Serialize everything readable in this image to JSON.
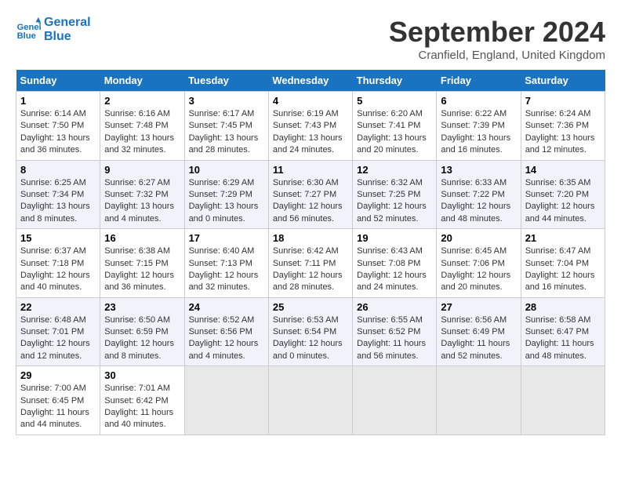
{
  "header": {
    "logo_line1": "General",
    "logo_line2": "Blue",
    "month": "September 2024",
    "location": "Cranfield, England, United Kingdom"
  },
  "weekdays": [
    "Sunday",
    "Monday",
    "Tuesday",
    "Wednesday",
    "Thursday",
    "Friday",
    "Saturday"
  ],
  "weeks": [
    [
      {
        "day": "1",
        "sunrise": "6:14 AM",
        "sunset": "7:50 PM",
        "daylight": "13 hours and 36 minutes."
      },
      {
        "day": "2",
        "sunrise": "6:16 AM",
        "sunset": "7:48 PM",
        "daylight": "13 hours and 32 minutes."
      },
      {
        "day": "3",
        "sunrise": "6:17 AM",
        "sunset": "7:45 PM",
        "daylight": "13 hours and 28 minutes."
      },
      {
        "day": "4",
        "sunrise": "6:19 AM",
        "sunset": "7:43 PM",
        "daylight": "13 hours and 24 minutes."
      },
      {
        "day": "5",
        "sunrise": "6:20 AM",
        "sunset": "7:41 PM",
        "daylight": "13 hours and 20 minutes."
      },
      {
        "day": "6",
        "sunrise": "6:22 AM",
        "sunset": "7:39 PM",
        "daylight": "13 hours and 16 minutes."
      },
      {
        "day": "7",
        "sunrise": "6:24 AM",
        "sunset": "7:36 PM",
        "daylight": "13 hours and 12 minutes."
      }
    ],
    [
      {
        "day": "8",
        "sunrise": "6:25 AM",
        "sunset": "7:34 PM",
        "daylight": "13 hours and 8 minutes."
      },
      {
        "day": "9",
        "sunrise": "6:27 AM",
        "sunset": "7:32 PM",
        "daylight": "13 hours and 4 minutes."
      },
      {
        "day": "10",
        "sunrise": "6:29 AM",
        "sunset": "7:29 PM",
        "daylight": "13 hours and 0 minutes."
      },
      {
        "day": "11",
        "sunrise": "6:30 AM",
        "sunset": "7:27 PM",
        "daylight": "12 hours and 56 minutes."
      },
      {
        "day": "12",
        "sunrise": "6:32 AM",
        "sunset": "7:25 PM",
        "daylight": "12 hours and 52 minutes."
      },
      {
        "day": "13",
        "sunrise": "6:33 AM",
        "sunset": "7:22 PM",
        "daylight": "12 hours and 48 minutes."
      },
      {
        "day": "14",
        "sunrise": "6:35 AM",
        "sunset": "7:20 PM",
        "daylight": "12 hours and 44 minutes."
      }
    ],
    [
      {
        "day": "15",
        "sunrise": "6:37 AM",
        "sunset": "7:18 PM",
        "daylight": "12 hours and 40 minutes."
      },
      {
        "day": "16",
        "sunrise": "6:38 AM",
        "sunset": "7:15 PM",
        "daylight": "12 hours and 36 minutes."
      },
      {
        "day": "17",
        "sunrise": "6:40 AM",
        "sunset": "7:13 PM",
        "daylight": "12 hours and 32 minutes."
      },
      {
        "day": "18",
        "sunrise": "6:42 AM",
        "sunset": "7:11 PM",
        "daylight": "12 hours and 28 minutes."
      },
      {
        "day": "19",
        "sunrise": "6:43 AM",
        "sunset": "7:08 PM",
        "daylight": "12 hours and 24 minutes."
      },
      {
        "day": "20",
        "sunrise": "6:45 AM",
        "sunset": "7:06 PM",
        "daylight": "12 hours and 20 minutes."
      },
      {
        "day": "21",
        "sunrise": "6:47 AM",
        "sunset": "7:04 PM",
        "daylight": "12 hours and 16 minutes."
      }
    ],
    [
      {
        "day": "22",
        "sunrise": "6:48 AM",
        "sunset": "7:01 PM",
        "daylight": "12 hours and 12 minutes."
      },
      {
        "day": "23",
        "sunrise": "6:50 AM",
        "sunset": "6:59 PM",
        "daylight": "12 hours and 8 minutes."
      },
      {
        "day": "24",
        "sunrise": "6:52 AM",
        "sunset": "6:56 PM",
        "daylight": "12 hours and 4 minutes."
      },
      {
        "day": "25",
        "sunrise": "6:53 AM",
        "sunset": "6:54 PM",
        "daylight": "12 hours and 0 minutes."
      },
      {
        "day": "26",
        "sunrise": "6:55 AM",
        "sunset": "6:52 PM",
        "daylight": "11 hours and 56 minutes."
      },
      {
        "day": "27",
        "sunrise": "6:56 AM",
        "sunset": "6:49 PM",
        "daylight": "11 hours and 52 minutes."
      },
      {
        "day": "28",
        "sunrise": "6:58 AM",
        "sunset": "6:47 PM",
        "daylight": "11 hours and 48 minutes."
      }
    ],
    [
      {
        "day": "29",
        "sunrise": "7:00 AM",
        "sunset": "6:45 PM",
        "daylight": "11 hours and 44 minutes."
      },
      {
        "day": "30",
        "sunrise": "7:01 AM",
        "sunset": "6:42 PM",
        "daylight": "11 hours and 40 minutes."
      },
      null,
      null,
      null,
      null,
      null
    ]
  ]
}
